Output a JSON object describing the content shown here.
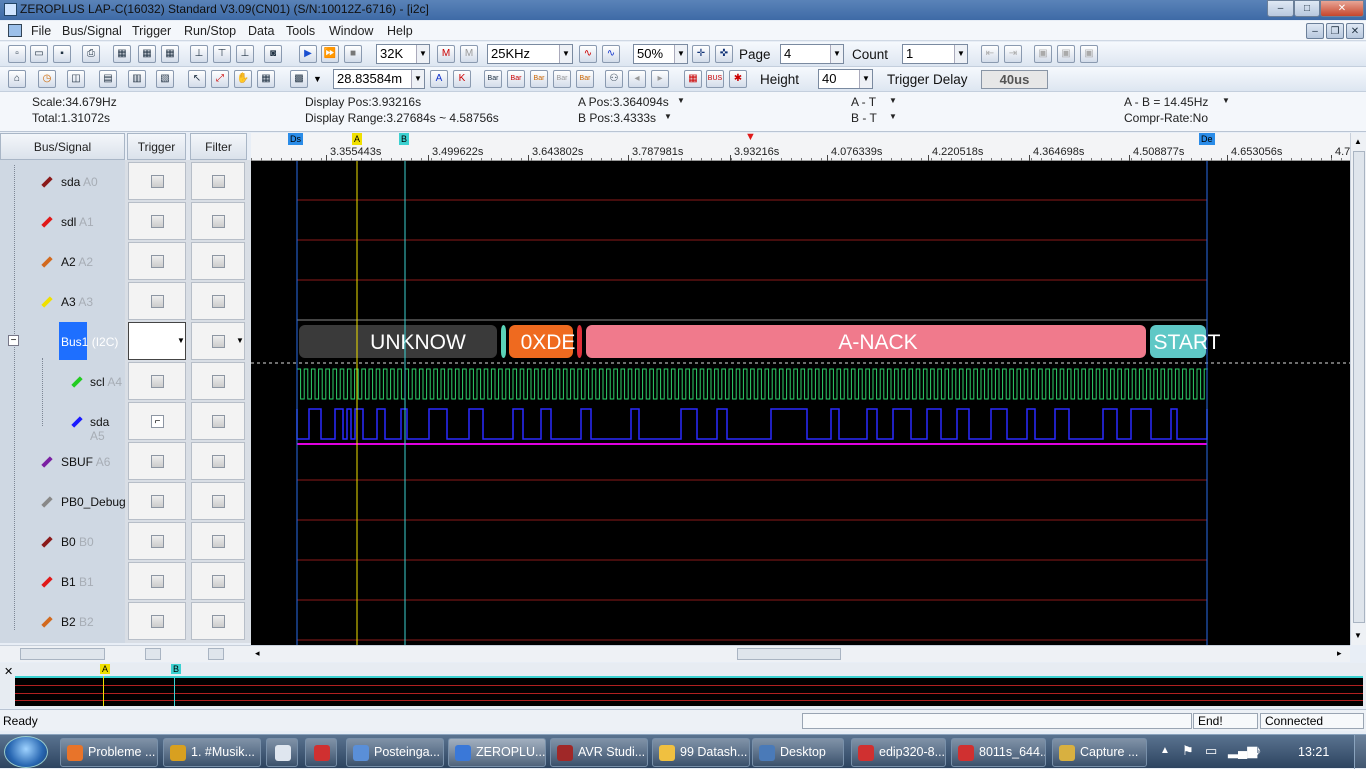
{
  "window": {
    "title": "ZEROPLUS LAP-C(16032) Standard V3.09(CN01) (S/N:10012Z-6716) - [i2c]"
  },
  "menu": [
    "File",
    "Bus/Signal",
    "Trigger",
    "Run/Stop",
    "Data",
    "Tools",
    "Window",
    "Help"
  ],
  "toolbar1": {
    "memory": "32K",
    "frequency": "25KHz",
    "zoom": "50%",
    "page_label": "Page",
    "page_value": "4",
    "count_label": "Count",
    "count_value": "1"
  },
  "toolbar2": {
    "position": "28.83584m",
    "height_label": "Height",
    "height_value": "40",
    "trigger_delay_label": "Trigger Delay",
    "trigger_delay_value": "40us"
  },
  "info": {
    "scale": "Scale:34.679Hz",
    "total": "Total:1.31072s",
    "display_pos": "Display Pos:3.93216s",
    "display_range": "Display Range:3.27684s ~ 4.58756s",
    "a_pos": "A Pos:3.364094s",
    "b_pos": "B Pos:3.4333s",
    "a_t": "A - T",
    "b_t": "B - T",
    "a_b": "A - B = 14.45Hz",
    "compr": "Compr-Rate:No"
  },
  "columns": {
    "bus_signal": "Bus/Signal",
    "trigger": "Trigger",
    "filter": "Filter"
  },
  "signals": [
    {
      "name": "sda",
      "sub": "A0",
      "color": "#8b1a1a"
    },
    {
      "name": "sdl",
      "sub": "A1",
      "color": "#e01919"
    },
    {
      "name": "A2",
      "sub": "A2",
      "color": "#d2691e"
    },
    {
      "name": "A3",
      "sub": "A3",
      "color": "#f0e000"
    },
    {
      "name": "Bus1",
      "sub": "(I2C)",
      "color": "#1e6fff"
    },
    {
      "name": "scl",
      "sub": "A4",
      "color": "#22cc22"
    },
    {
      "name": "sda",
      "sub": "A5",
      "color": "#1a1aff"
    },
    {
      "name": "SBUF",
      "sub": "A6",
      "color": "#7a1fa2"
    },
    {
      "name": "PB0_Debug",
      "sub": "",
      "color": "#888888"
    },
    {
      "name": "B0",
      "sub": "B0",
      "color": "#8b1a1a"
    },
    {
      "name": "B1",
      "sub": "B1",
      "color": "#e01919"
    },
    {
      "name": "B2",
      "sub": "B2",
      "color": "#d2691e"
    }
  ],
  "ruler": {
    "ticks": [
      "3.355443s",
      "3.499622s",
      "3.643802s",
      "3.787981s",
      "3.93216s",
      "4.076339s",
      "4.220518s",
      "4.364698s",
      "4.508877s",
      "4.653056s",
      "4.7"
    ],
    "marker_ds": "Ds",
    "marker_a": "A",
    "marker_b": "B",
    "marker_de": "De"
  },
  "bus_segments": [
    "UNKNOW",
    "0XDE",
    "A-NACK",
    "START"
  ],
  "overview": {
    "marker_a": "A",
    "marker_b": "B"
  },
  "status": {
    "ready": "Ready",
    "end": "End!",
    "connected": "Connected"
  },
  "taskbar": {
    "items": [
      "Probleme ...",
      "1. #Musik...",
      "Posteinga...",
      "ZEROPLU...",
      "AVR Studi...",
      "99 Datash...",
      "Desktop",
      "edip320-8....",
      "8011s_644...",
      "Capture ..."
    ],
    "clock": "13:21"
  }
}
